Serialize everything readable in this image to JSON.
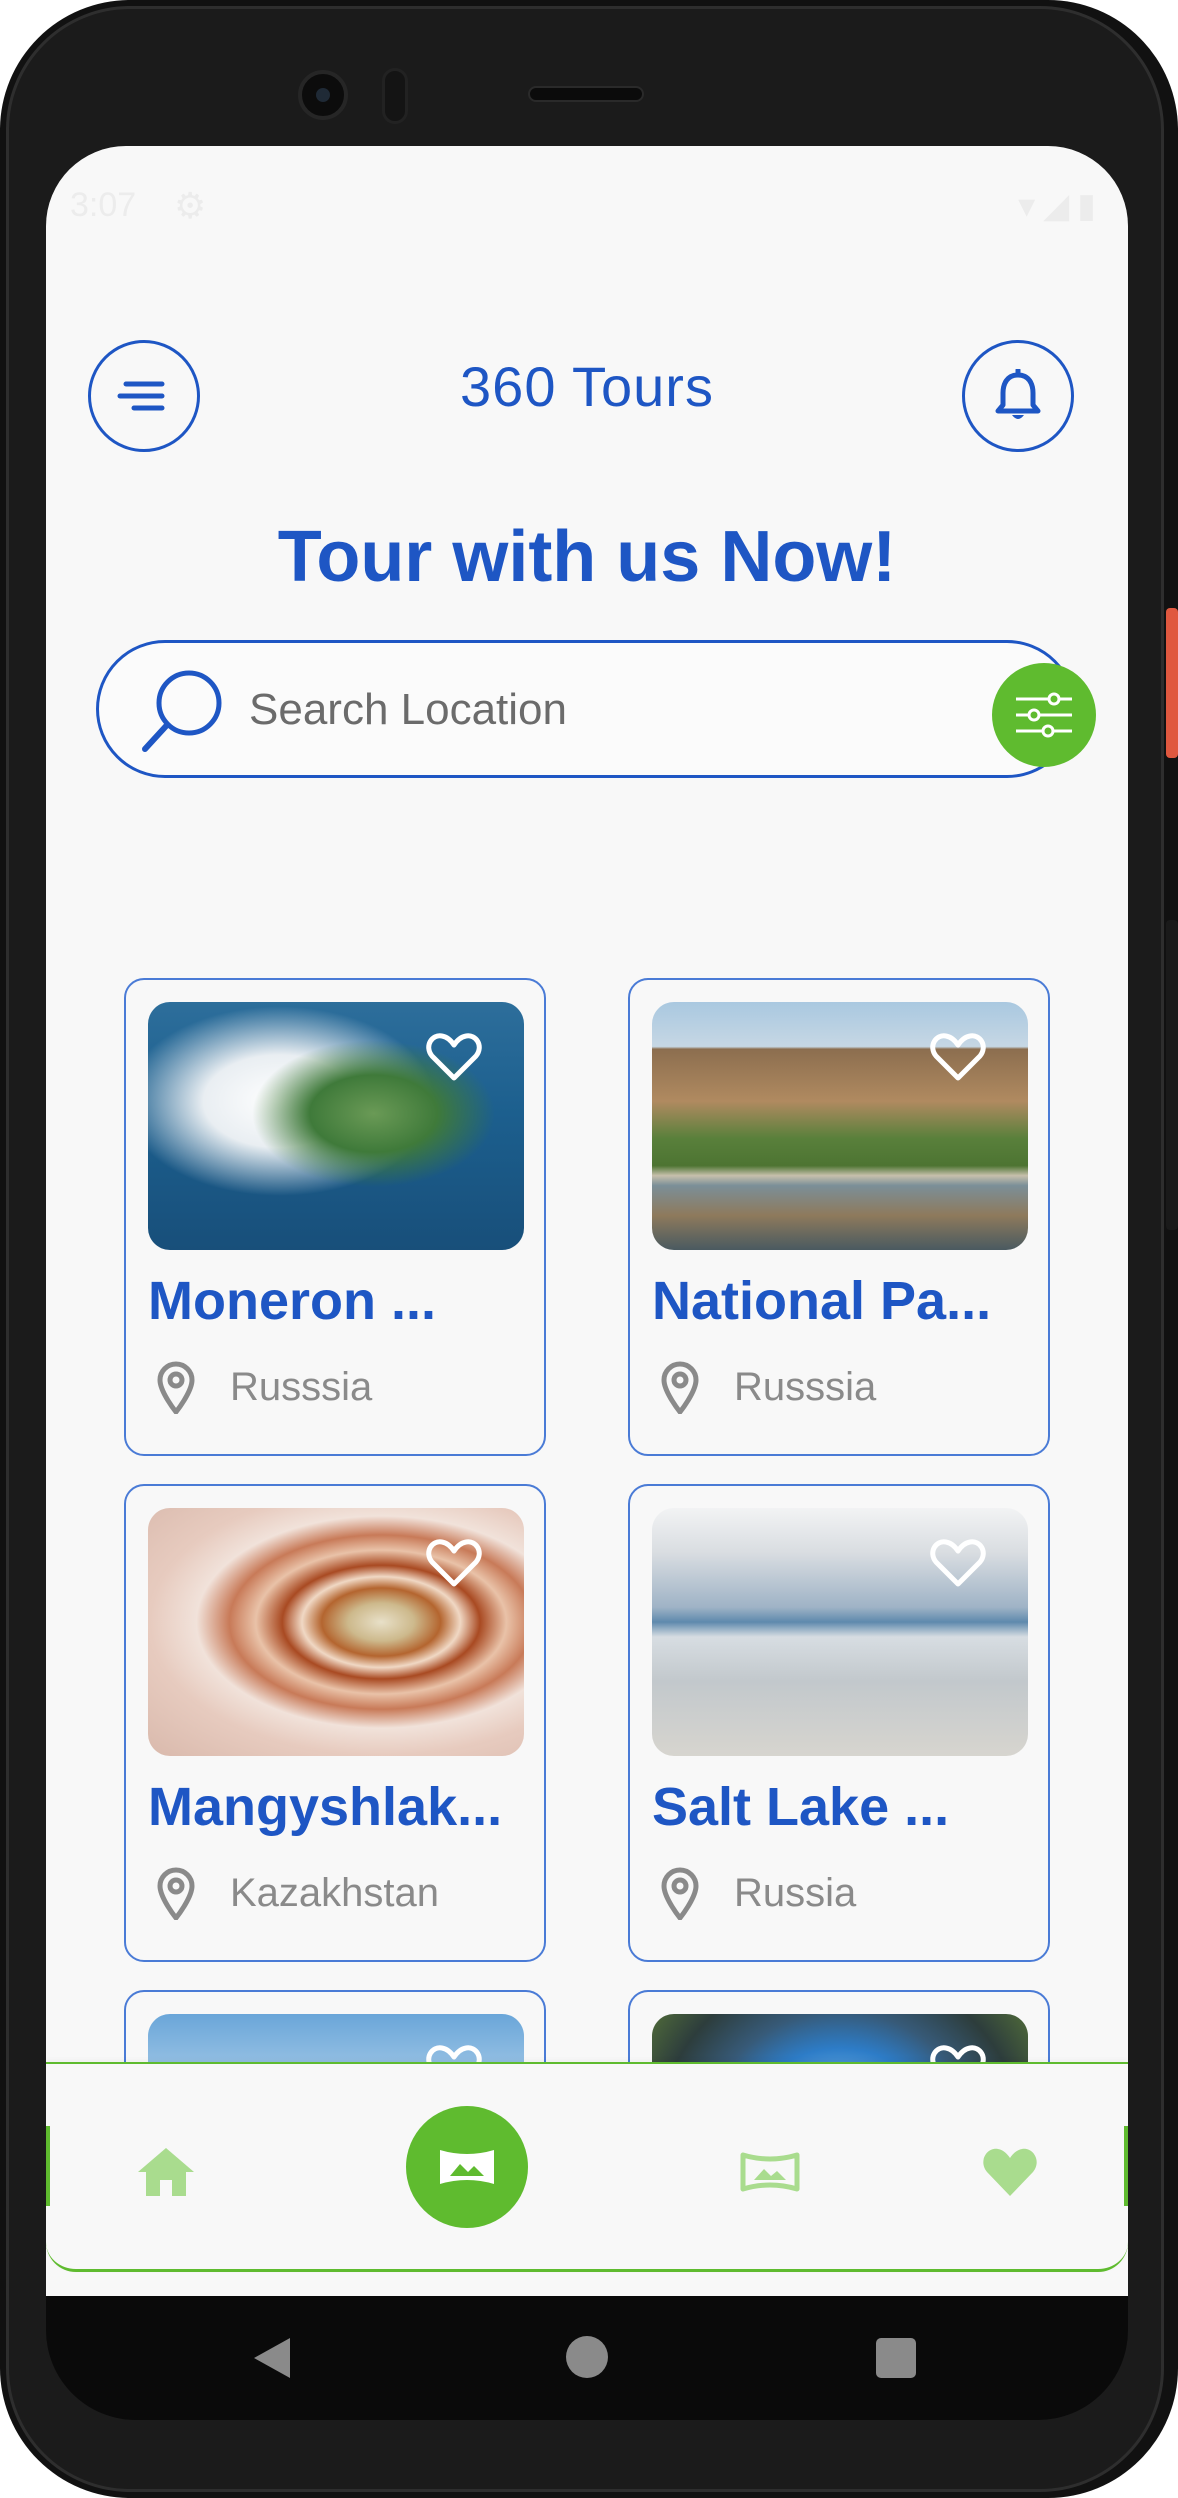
{
  "status_bar": {
    "time": "3:07",
    "settings_icon": "gear-icon",
    "right_icons": "wifi signal battery"
  },
  "header": {
    "title": "360 Tours",
    "menu_icon": "menu-lines-icon",
    "notification_icon": "bell-icon",
    "accent_color": "#1e56c4"
  },
  "headline": "Tour with us Now!",
  "search": {
    "placeholder": "Search Location",
    "value": "",
    "filter_icon": "sliders-icon",
    "filter_color": "#5fbb2f"
  },
  "tours": [
    {
      "title": "Moneron ...",
      "location": "Russsia",
      "image": "moneron-island-aerial"
    },
    {
      "title": "National Pa...",
      "location": "Russsia",
      "image": "lena-pillars-river"
    },
    {
      "title": "Mangyshlak...",
      "location": "Kazakhstan",
      "image": "mangyshlak-rock-layers"
    },
    {
      "title": "Salt Lake ...",
      "location": "Russia",
      "image": "salt-lake-reflection"
    },
    {
      "title": "",
      "location": "",
      "image": "beach-resort"
    },
    {
      "title": "",
      "location": "",
      "image": "city-tiny-planet"
    }
  ],
  "bottom_nav": {
    "items": [
      {
        "name": "home",
        "icon": "home-icon",
        "active": false
      },
      {
        "name": "tours",
        "icon": "panorama-icon",
        "active": true
      },
      {
        "name": "gallery",
        "icon": "panorama-outline-icon",
        "active": false
      },
      {
        "name": "favorites",
        "icon": "heart-icon",
        "active": false
      }
    ],
    "active_color": "#5fbb2f",
    "inactive_color": "#a9dc8e"
  },
  "system_nav": {
    "back": "back-icon",
    "home": "home-circle-icon",
    "recents": "recents-icon"
  }
}
